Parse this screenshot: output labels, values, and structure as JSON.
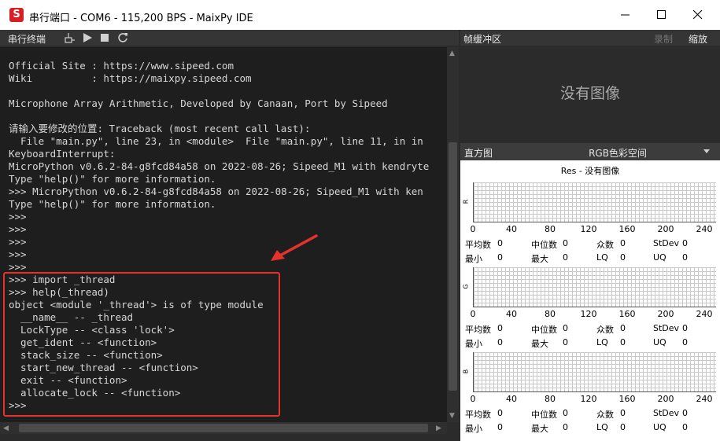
{
  "window": {
    "logo_letter": "S",
    "title": "串行端口 - COM6 - 115,200 BPS - MaixPy IDE"
  },
  "terminal": {
    "title": "串行终端",
    "lines": [
      "Official Site : https://www.sipeed.com",
      "Wiki          : https://maixpy.sipeed.com",
      "",
      "Microphone Array Arithmetic, Developed by Canaan, Port by Sipeed",
      "",
      "请输入要修改的位置: Traceback (most recent call last):",
      "  File \"main.py\", line 23, in <module>  File \"main.py\", line 11, in in",
      "KeyboardInterrupt:",
      "MicroPython v0.6.2-84-g8fcd84a58 on 2022-08-26; Sipeed_M1 with kendryte",
      "Type \"help()\" for more information.",
      ">>> MicroPython v0.6.2-84-g8fcd84a58 on 2022-08-26; Sipeed_M1 with ken",
      "Type \"help()\" for more information.",
      ">>>",
      ">>>",
      ">>>",
      ">>>",
      ">>>",
      ">>> import _thread",
      ">>> help(_thread)",
      "object <module '_thread'> is of type module",
      "  __name__ -- _thread",
      "  LockType -- <class 'lock'>",
      "  get_ident -- <function>",
      "  stack_size -- <function>",
      "  start_new_thread -- <function>",
      "  exit -- <function>",
      "  allocate_lock -- <function>",
      ">>>"
    ]
  },
  "framebuffer": {
    "title": "帧缓冲区",
    "record_label": "录制",
    "zoom_label": "缩放",
    "empty_text": "没有图像"
  },
  "histogram": {
    "title": "直方图",
    "color_space": "RGB色彩空间",
    "res_line": "Res  - 没有图像",
    "ticks": [
      "0",
      "40",
      "80",
      "120",
      "160",
      "200",
      "240"
    ],
    "stat_labels": {
      "mean": "平均数",
      "median": "中位数",
      "mode": "众数",
      "stdev": "StDev",
      "min": "最小",
      "max": "最大",
      "lq": "LQ",
      "uq": "UQ"
    },
    "channels": [
      {
        "name": "R",
        "mean": "0",
        "median": "0",
        "mode": "0",
        "stdev": "0",
        "min": "0",
        "max": "0",
        "lq": "0",
        "uq": "0"
      },
      {
        "name": "G",
        "mean": "0",
        "median": "0",
        "mode": "0",
        "stdev": "0",
        "min": "0",
        "max": "0",
        "lq": "0",
        "uq": "0"
      },
      {
        "name": "B",
        "mean": "0",
        "median": "0",
        "mode": "0",
        "stdev": "0",
        "min": "0",
        "max": "0",
        "lq": "0",
        "uq": "0"
      }
    ]
  },
  "colors": {
    "highlight_border": "#e5322d",
    "annotation_arrow": "#e5322d",
    "logo_red": "#d81e25"
  }
}
